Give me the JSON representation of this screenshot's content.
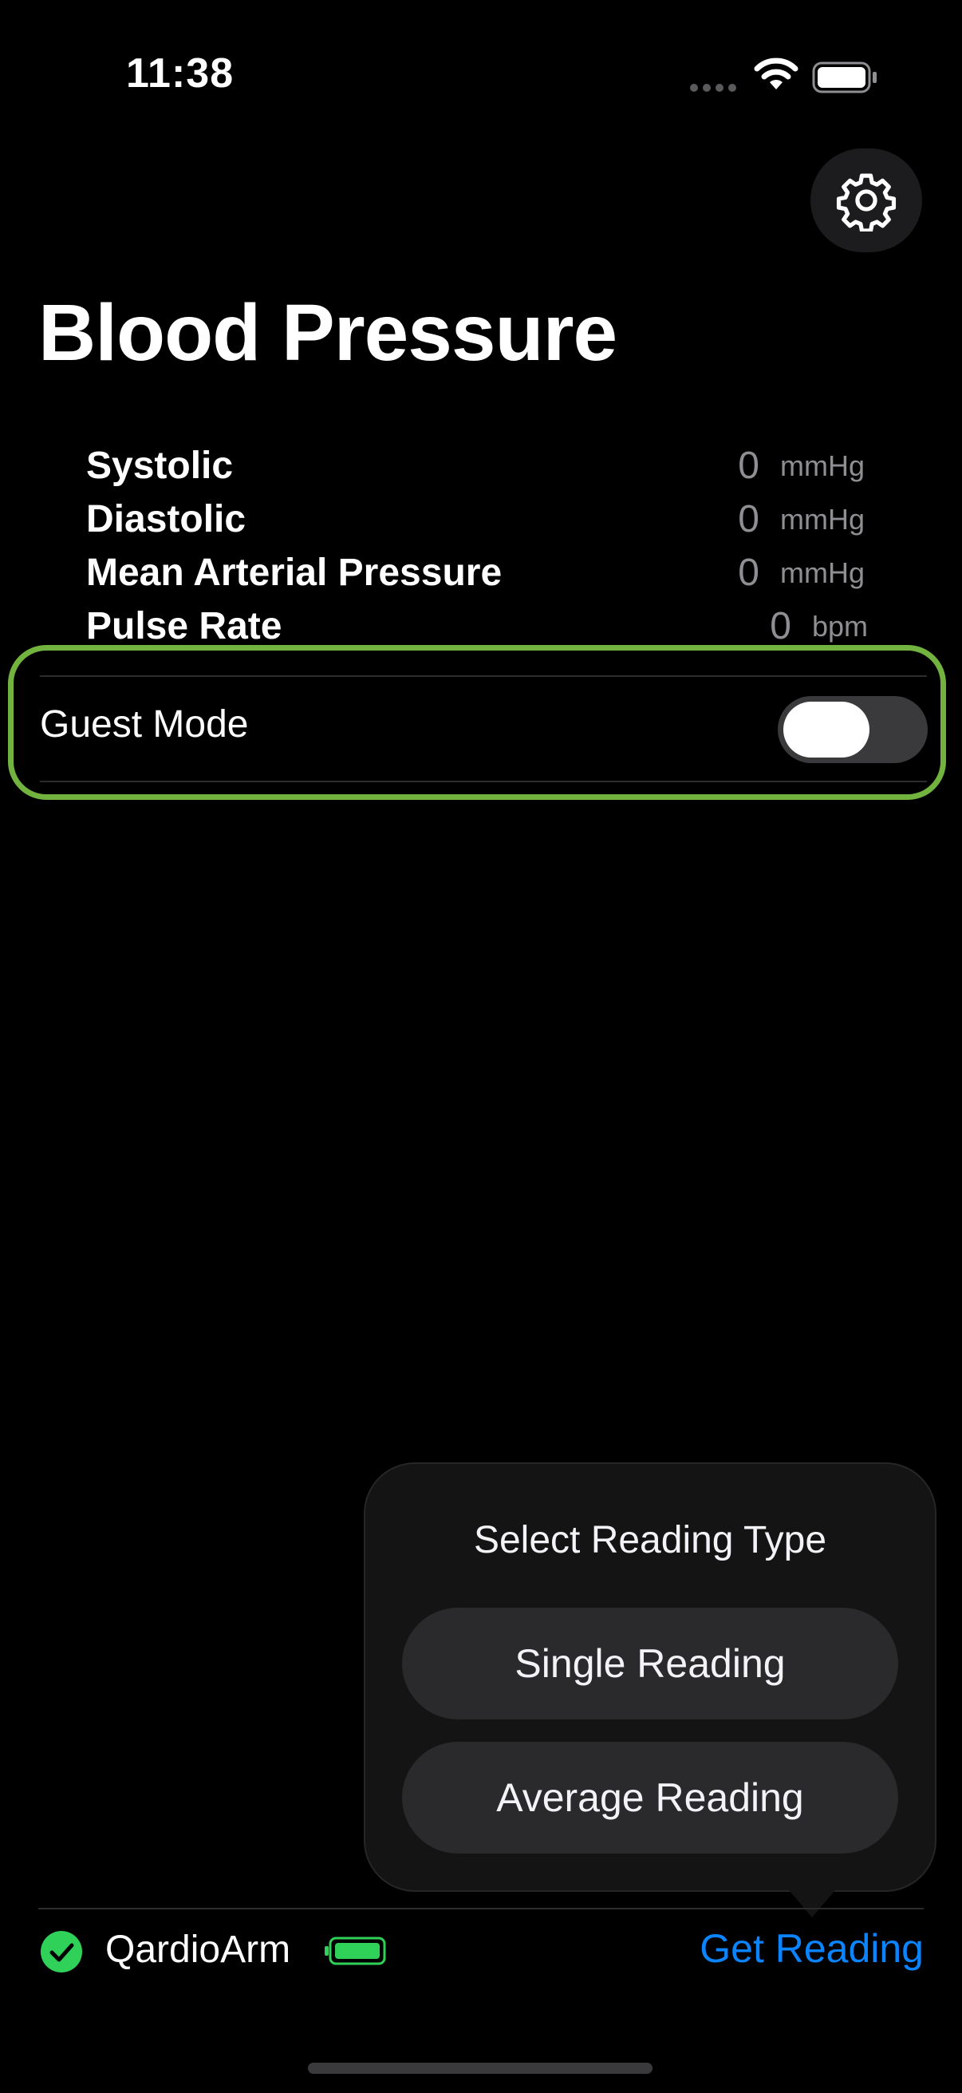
{
  "status_bar": {
    "time": "11:38"
  },
  "page": {
    "title": "Blood Pressure"
  },
  "metrics": [
    {
      "label": "Systolic",
      "value": "0",
      "unit": "mmHg"
    },
    {
      "label": "Diastolic",
      "value": "0",
      "unit": "mmHg"
    },
    {
      "label": "Mean Arterial Pressure",
      "value": "0",
      "unit": "mmHg"
    },
    {
      "label": "Pulse Rate",
      "value": "0",
      "unit": "bpm"
    }
  ],
  "guest_mode": {
    "label": "Guest Mode",
    "enabled": false
  },
  "popover": {
    "title": "Select Reading Type",
    "options": [
      "Single Reading",
      "Average Reading"
    ]
  },
  "bottom_bar": {
    "device_name": "QardioArm",
    "device_connected": true,
    "action_label": "Get Reading"
  },
  "colors": {
    "accent": "#0a84ff",
    "connected": "#30d158",
    "highlight_frame": "#72b33f"
  },
  "icons": {
    "settings": "gear-icon",
    "connected": "checkmark-circle-icon",
    "device_battery": "battery-charging-icon"
  }
}
